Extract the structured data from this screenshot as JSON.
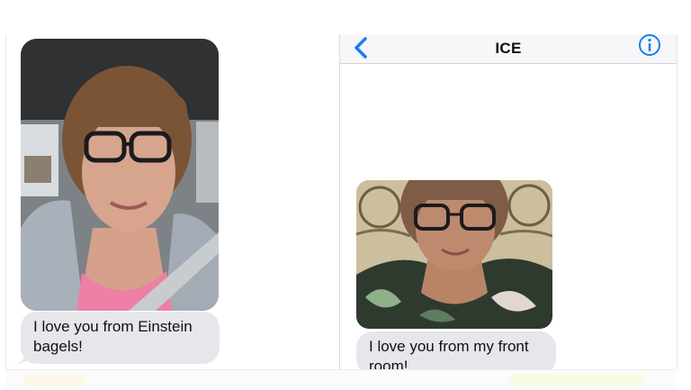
{
  "left_thread": {
    "photo": "selfie-in-car-photo",
    "message": "I love you from Einstein bagels!"
  },
  "right_thread": {
    "nav": {
      "title": "ICE",
      "back_icon": "chevron-left-icon",
      "info_icon": "info-circle-icon"
    },
    "photo": "selfie-at-home-photo",
    "message": "I love you from my front room!"
  },
  "colors": {
    "bubble_gray": "#e6e6eb",
    "ios_blue": "#1a7cf5",
    "nav_bar": "#f7f7f9"
  }
}
